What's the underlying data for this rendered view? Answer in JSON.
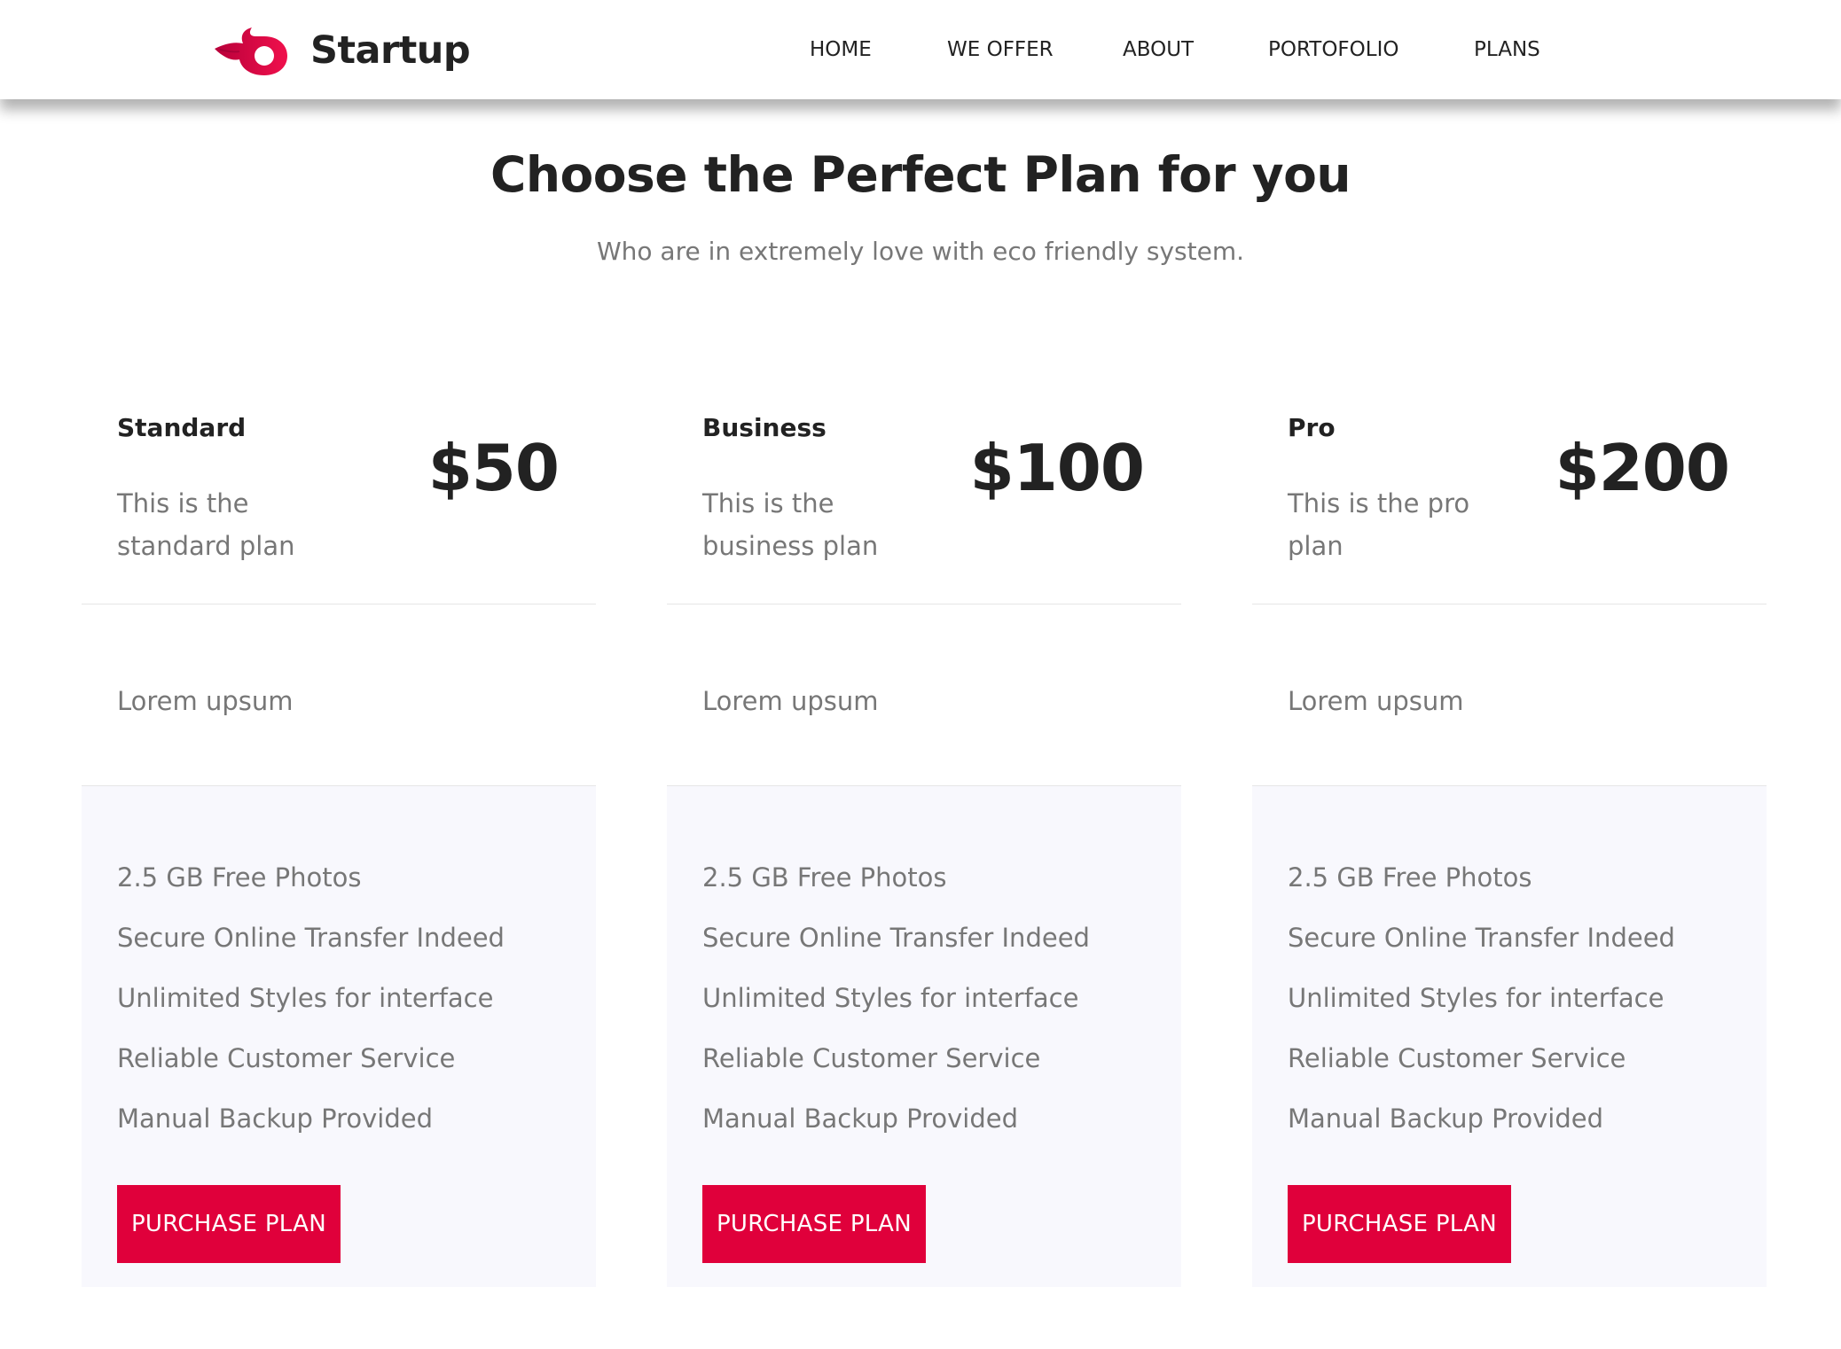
{
  "brand": {
    "name": "Startup",
    "accent_color": "#e0003b",
    "logo_icon": "flame-ring-icon"
  },
  "nav": {
    "items": [
      {
        "label": "HOME"
      },
      {
        "label": "WE OFFER"
      },
      {
        "label": "ABOUT"
      },
      {
        "label": "PORTOFOLIO"
      },
      {
        "label": "PLANS"
      }
    ]
  },
  "pricing": {
    "title": "Choose the Perfect Plan for you",
    "subtitle": "Who are in extremely love with eco friendly system.",
    "plans": [
      {
        "name": "Standard",
        "description": "This is the standard plan",
        "price": "$50",
        "note": "Lorem upsum",
        "features": [
          "2.5 GB Free Photos",
          "Secure Online Transfer Indeed",
          "Unlimited Styles for interface",
          "Reliable Customer Service",
          "Manual Backup Provided"
        ],
        "button_label": "PURCHASE PLAN"
      },
      {
        "name": "Business",
        "description": "This is the business plan",
        "price": "$100",
        "note": "Lorem upsum",
        "features": [
          "2.5 GB Free Photos",
          "Secure Online Transfer Indeed",
          "Unlimited Styles for interface",
          "Reliable Customer Service",
          "Manual Backup Provided"
        ],
        "button_label": "PURCHASE PLAN"
      },
      {
        "name": "Pro",
        "description": "This is the pro plan",
        "price": "$200",
        "note": "Lorem upsum",
        "features": [
          "2.5 GB Free Photos",
          "Secure Online Transfer Indeed",
          "Unlimited Styles for interface",
          "Reliable Customer Service",
          "Manual Backup Provided"
        ],
        "button_label": "PURCHASE PLAN"
      }
    ]
  }
}
